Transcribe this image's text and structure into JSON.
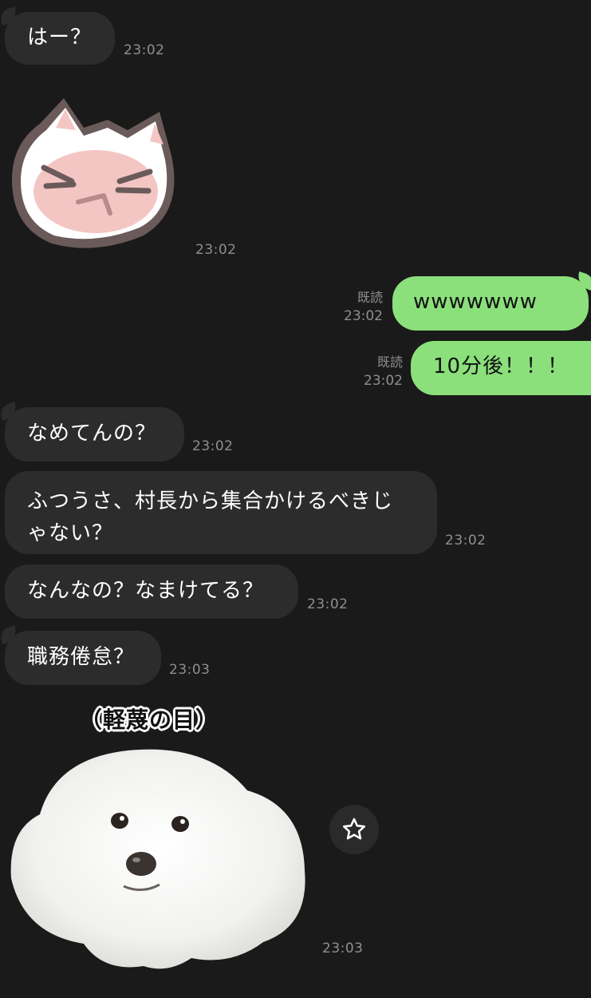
{
  "messages": {
    "m1": {
      "text": "はー？",
      "time": "23:02"
    },
    "sticker1": {
      "name": "cat-sticker",
      "time": "23:02"
    },
    "m2": {
      "text": "wwwwwww",
      "read": "既読",
      "time": "23:02"
    },
    "m3": {
      "text": "10分後！！！",
      "read": "既読",
      "time": "23:02"
    },
    "m4": {
      "text": "なめてんの？",
      "time": "23:02"
    },
    "m5": {
      "line1": "ふつうさ、村長から集合かけるべきじ",
      "line2": "ゃない？",
      "time": "23:02"
    },
    "m6": {
      "text": "なんなの？なまけてる？",
      "time": "23:02"
    },
    "m7": {
      "text": "職務倦怠？",
      "time": "23:03"
    },
    "sticker2": {
      "caption": "（軽蔑の目）",
      "time": "23:03"
    }
  },
  "actions": {
    "favorite_icon": "star-icon"
  },
  "colors": {
    "background": "#1a1a1a",
    "incoming": "#2c2c2c",
    "outgoing": "#8be07b",
    "timestamp": "#8f8f8f"
  }
}
